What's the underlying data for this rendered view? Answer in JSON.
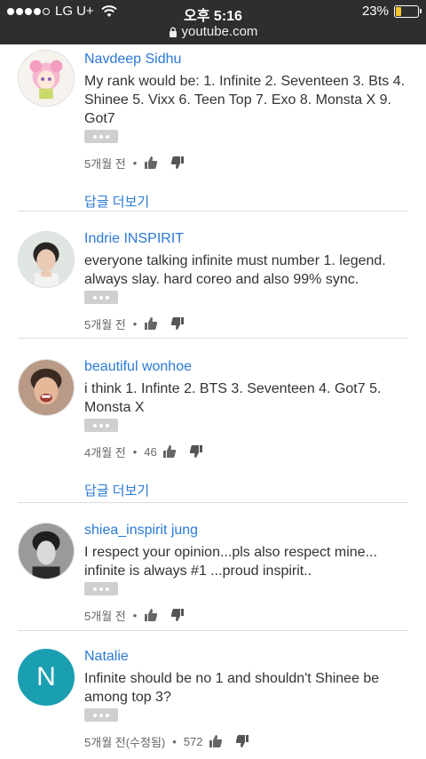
{
  "status_bar": {
    "carrier": "LG U+",
    "time": "오후 5:16",
    "battery": "23%",
    "battery_level": 0.23,
    "url": "youtube.com"
  },
  "comments": [
    {
      "author": "Navdeep Sidhu",
      "text": "My rank would be: 1. Infinite 2. Seventeen 3. Bts 4. Shinee 5. Vixx 6. Teen Top 7. Exo 8. Monsta X 9. Got7",
      "time": "5개월 전",
      "likes": "",
      "replies_link": "답글 더보기"
    },
    {
      "author": "Indrie INSPIRIT",
      "text": "everyone talking infinite must number 1. legend. always slay. hard coreo and also 99% sync.",
      "time": "5개월 전",
      "likes": "",
      "replies_link": ""
    },
    {
      "author": "beautiful wonhoe",
      "text": "i think 1. Infinte 2. BTS 3. Seventeen 4. Got7 5. Monsta X",
      "time": "4개월 전",
      "likes": "46",
      "replies_link": "답글 더보기"
    },
    {
      "author": "shiea_inspirit jung",
      "text": "I respect your opinion...pls also respect mine... infinite is always #1 ...proud inspirit..",
      "time": "5개월 전",
      "likes": "",
      "replies_link": ""
    },
    {
      "author": "Natalie",
      "avatar_letter": "N",
      "text": "Infinite should be no 1 and shouldn't Shinee be among top 3?",
      "time": "5개월 전(수정됨)",
      "likes": "572",
      "replies_link": ""
    }
  ],
  "colors": {
    "link": "#2a79d6",
    "status_bar_bg": "#2e2e2e",
    "natalie_avatar": "#1a9fb0"
  }
}
